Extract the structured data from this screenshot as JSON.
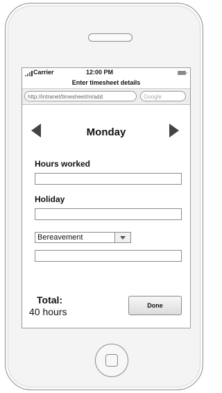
{
  "status_bar": {
    "carrier": "Carrier",
    "time": "12:00 PM"
  },
  "browser": {
    "title": "Enter timesheet details",
    "url": "http://intranet/timesheet/m/add",
    "search_placeholder": "Google"
  },
  "day_nav": {
    "day": "Monday",
    "prev_icon": "left-arrow-icon",
    "next_icon": "right-arrow-icon"
  },
  "form": {
    "hours_worked_label": "Hours worked",
    "hours_worked_value": "",
    "holiday_label": "Holiday",
    "holiday_value": "",
    "leave_type_selected": "Bereavement",
    "leave_value": ""
  },
  "footer": {
    "total_label": "Total:",
    "total_value": "40 hours",
    "done_label": "Done"
  }
}
